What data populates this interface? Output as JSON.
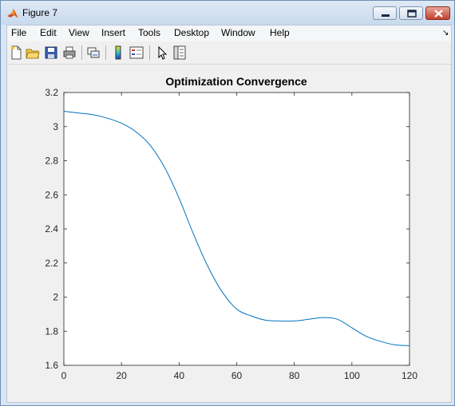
{
  "window": {
    "title": "Figure 7",
    "icon": "matlab-icon",
    "controls": [
      "minimize-icon",
      "maximize-icon",
      "close-icon"
    ]
  },
  "menu": {
    "items": [
      "File",
      "Edit",
      "View",
      "Insert",
      "Tools",
      "Desktop",
      "Window",
      "Help"
    ],
    "overflow_icon": "dock-arrow-icon"
  },
  "toolbar": {
    "tools": [
      "new-figure-icon",
      "open-file-icon",
      "save-icon",
      "print-icon",
      "link-plot-icon",
      "insert-colorbar-icon",
      "insert-legend-icon",
      "edit-plot-arrow-icon",
      "property-inspector-icon"
    ]
  },
  "colors": {
    "line": "#0072bd",
    "window_frame": "#dae6f3",
    "background": "#f0f0f0"
  },
  "chart_data": {
    "type": "line",
    "title": "Optimization Convergence",
    "xlabel": "",
    "ylabel": "",
    "xlim": [
      0,
      120
    ],
    "ylim": [
      1.6,
      3.2
    ],
    "xticks": [
      "0",
      "20",
      "40",
      "60",
      "80",
      "100",
      "120"
    ],
    "yticks": [
      "1.6",
      "1.8",
      "2",
      "2.2",
      "2.4",
      "2.6",
      "2.8",
      "3",
      "3.2"
    ],
    "grid": false,
    "series": [
      {
        "x": [
          0,
          5,
          10,
          15,
          20,
          25,
          30,
          35,
          40,
          45,
          50,
          55,
          60,
          65,
          70,
          75,
          80,
          85,
          90,
          95,
          100,
          105,
          110,
          115,
          120
        ],
        "y": [
          3.09,
          3.08,
          3.07,
          3.05,
          3.02,
          2.97,
          2.89,
          2.76,
          2.58,
          2.37,
          2.18,
          2.03,
          1.93,
          1.89,
          1.865,
          1.86,
          1.86,
          1.87,
          1.88,
          1.87,
          1.82,
          1.77,
          1.74,
          1.72,
          1.715
        ]
      }
    ]
  }
}
